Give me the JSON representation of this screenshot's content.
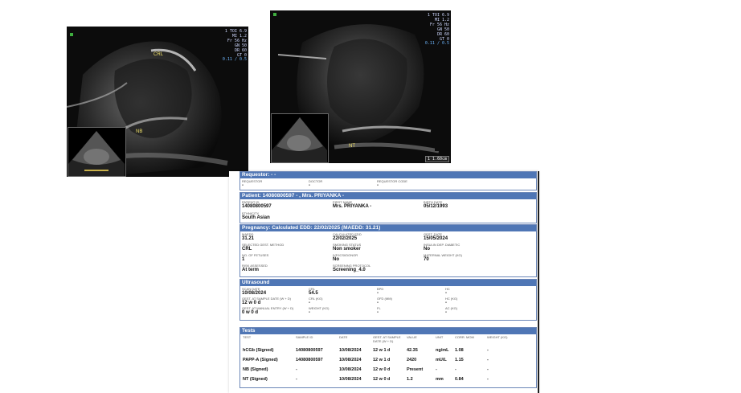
{
  "ultrasound_left": {
    "overlay_lines": [
      "1 TOI 6.9",
      "MI 1.2",
      "Fr 56 Hz",
      "GN 50",
      "DR 60",
      "GT 0"
    ],
    "scale_text": "0.11 / 0.5",
    "label_crl": "CRL",
    "label_nb": "NB"
  },
  "ultrasound_right": {
    "overlay_lines": [
      "1 TOI 6.9",
      "MI 1.2",
      "Fr 56 Hz",
      "GN 50",
      "DR 60",
      "GT 0"
    ],
    "scale_text": "0.11 / 0.5",
    "label_nt": "NT",
    "badge": "1 1.60cm"
  },
  "report": {
    "requestor": {
      "header": "Requestor: - -",
      "cols": [
        {
          "key": "REQUESTOR",
          "value": "-"
        },
        {
          "key": "DOCTOR",
          "value": "-"
        },
        {
          "key": "REQUESTOR CODE",
          "value": "-"
        }
      ]
    },
    "patient": {
      "header": "Patient: 14080800597 - , Mrs. PRIYANKA -",
      "fields": [
        {
          "key": "PATIENT ID",
          "value": "14080800597"
        },
        {
          "key": "FIRST NAME",
          "value": "Mrs. PRIYANKA -"
        },
        {
          "key": "BIRTH DATE",
          "value": "05/12/1993"
        },
        {
          "key": "ETHNICITY",
          "value": "South Asian"
        }
      ]
    },
    "pregnancy": {
      "header": "Pregnancy: Calculated EDD: 22/02/2025 (MAEDD: 31.21)",
      "fields": [
        {
          "key": "MAEDD",
          "value": "31.21"
        },
        {
          "key": "CALCULATED EDD",
          "value": "22/02/2025"
        },
        {
          "key": "GEST. DATE",
          "value": "15/05/2024"
        },
        {
          "key": "SELECTED GEST. METHOD",
          "value": "CRL"
        },
        {
          "key": "SMOKING STATUS",
          "value": "Non smoker"
        },
        {
          "key": "INSULIN DEP. DIABETIC",
          "value": "No"
        },
        {
          "key": "NO. OF FETUSES",
          "value": "1"
        },
        {
          "key": "IVF/ICSI/DONOR",
          "value": "No"
        },
        {
          "key": "MATERNAL WEIGHT (KG)",
          "value": "70"
        },
        {
          "key": "RISK ASSESSED",
          "value": "At term"
        },
        {
          "key": "SCREENING PROTOCOL",
          "value": "Screening_4.0"
        }
      ]
    },
    "ultrasound": {
      "header": "Ultrasound",
      "fields": [
        {
          "key": "SCAN DATE",
          "value": "10/08/2024"
        },
        {
          "key": "CRL",
          "value": "54.5"
        },
        {
          "key": "BPD",
          "value": "-"
        },
        {
          "key": "HC",
          "value": "-"
        },
        {
          "key": "GEST. AT SAMPLE DATE (W + D)",
          "value": "12 w 0 d"
        },
        {
          "key": "CRL (KG)",
          "value": "-"
        },
        {
          "key": "OFD (MM)",
          "value": "-"
        },
        {
          "key": "HC (KG)",
          "value": "-"
        },
        {
          "key": "GEST. AT MANUAL ENTRY (W + D)",
          "value": "0 w 0 d"
        },
        {
          "key": "WEIGHT (KG)",
          "value": "-"
        },
        {
          "key": "FL",
          "value": "-"
        },
        {
          "key": "AC (KG)",
          "value": "-"
        }
      ]
    },
    "tests": {
      "header": "Tests",
      "columns": [
        "TEST",
        "SAMPLE ID",
        "DATE",
        "GEST. AT SAMPLE DATE (W + D)",
        "VALUE",
        "UNIT",
        "CORR. MOM",
        "WEIGHT (KG)"
      ],
      "rows": [
        [
          "hCGb (Signed)",
          "14080800597",
          "10/08/2024",
          "12 w 1 d",
          "42.35",
          "ng/mL",
          "1.08",
          "-"
        ],
        [
          "PAPP-A (Signed)",
          "14080800597",
          "10/08/2024",
          "12 w 1 d",
          "2420",
          "mU/L",
          "1.15",
          "-"
        ],
        [
          "NB (Signed)",
          "-",
          "10/08/2024",
          "12 w 0 d",
          "Present",
          "-",
          "-",
          "-"
        ],
        [
          "NT (Signed)",
          "-",
          "10/08/2024",
          "12 w 0 d",
          "1.2",
          "mm",
          "0.84",
          "-"
        ]
      ]
    }
  }
}
